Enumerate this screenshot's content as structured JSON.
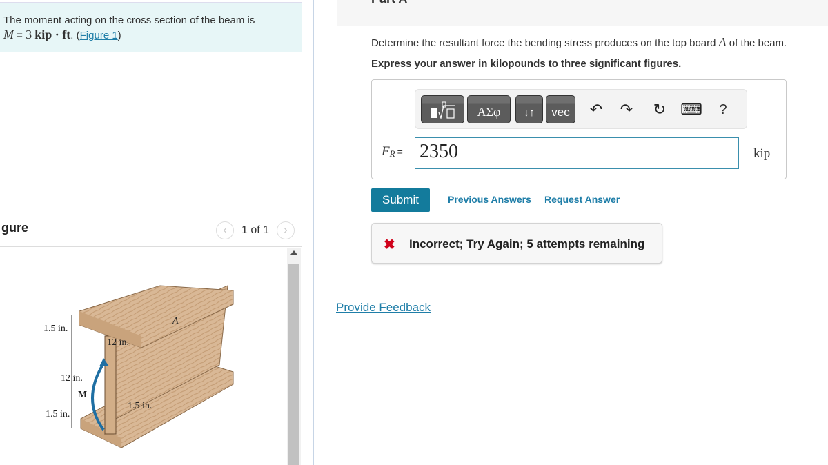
{
  "problem": {
    "text": "The moment acting on the cross section of the beam is",
    "moment_var": "M",
    "equals": " = ",
    "moment_value": "3",
    "moment_units": "kip · ft",
    "suffix_open": ". (",
    "figure_link": "Figure 1",
    "suffix_close": ")"
  },
  "figure_panel": {
    "title": "gure",
    "pager": "1 of 1",
    "prev_icon": "chevron-left-icon",
    "next_icon": "chevron-right-icon",
    "labels": {
      "top_flange_thickness": "1.5 in.",
      "flange_width": "12 in.",
      "web_height": "12 in.",
      "moment": "M",
      "web_thickness": "1.5 in.",
      "bottom_flange_thickness": "1.5 in.",
      "board": "A"
    },
    "colors": {
      "wood": "#d8b48d",
      "wood_dark": "#b48b62",
      "moment_arrow": "#1f6fa3"
    }
  },
  "part": {
    "label": "Part A",
    "question_prefix": "Determine the resultant force the bending stress produces on the top board ",
    "question_var": "A",
    "question_suffix": " of the beam.",
    "instruction": "Express your answer in kilopounds to three significant figures."
  },
  "toolbar": {
    "buttons": [
      {
        "name": "templates",
        "icon": "fraction-root-icon",
        "label": "■√□"
      },
      {
        "name": "greek",
        "label": "ΑΣφ"
      },
      {
        "name": "arrows",
        "label": "↓↑"
      },
      {
        "name": "vector",
        "label": "vec"
      }
    ],
    "undo_icon": "↶",
    "redo_icon": "↷",
    "reset_icon": "↻",
    "keyboard_icon": "⌨",
    "help_label": "?"
  },
  "answer": {
    "var": "F",
    "sub": "R",
    "equals": "=",
    "value": "2350",
    "unit": "kip"
  },
  "actions": {
    "submit": "Submit",
    "previous_answers": "Previous Answers",
    "request_answer": "Request Answer"
  },
  "feedback": {
    "icon": "✖",
    "text": "Incorrect; Try Again; 5 attempts remaining",
    "icon_color": "#d0021b"
  },
  "provide_feedback": "Provide Feedback"
}
